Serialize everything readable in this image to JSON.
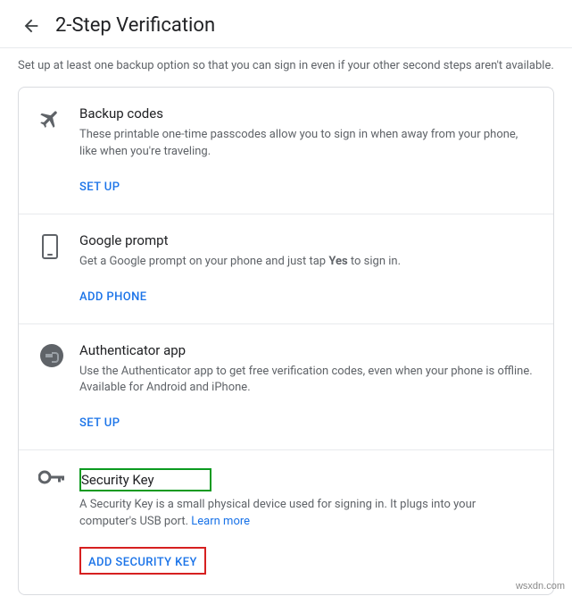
{
  "header": {
    "title": "2-Step Verification"
  },
  "subtitle": "Set up at least one backup option so that you can sign in even if your other second steps aren't available.",
  "sections": {
    "backup": {
      "title": "Backup codes",
      "desc": "These printable one-time passcodes allow you to sign in when away from your phone, like when you're traveling.",
      "action": "SET UP"
    },
    "prompt": {
      "title": "Google prompt",
      "desc_before": "Get a Google prompt on your phone and just tap ",
      "desc_bold": "Yes",
      "desc_after": " to sign in.",
      "action": "ADD PHONE"
    },
    "auth": {
      "title": "Authenticator app",
      "desc": "Use the Authenticator app to get free verification codes, even when your phone is offline. Available for Android and iPhone.",
      "action": "SET UP"
    },
    "key": {
      "title": "Security Key",
      "desc": "A Security Key is a small physical device used for signing in. It plugs into your computer's USB port. ",
      "learn_more": "Learn more",
      "action": "ADD SECURITY KEY"
    }
  },
  "watermark": "wsxdn.com"
}
